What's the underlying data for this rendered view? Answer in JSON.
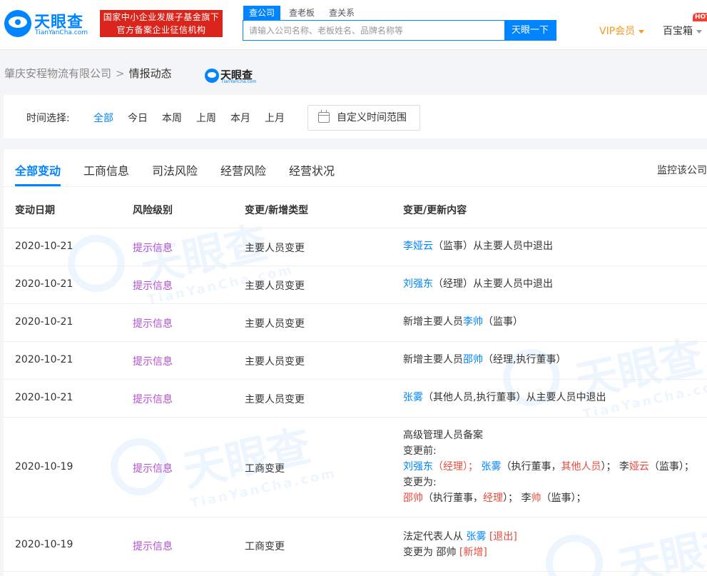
{
  "header": {
    "logo_cn": "天眼查",
    "logo_en": "TianYanCha.com",
    "gov_badge_line1": "国家中小企业发展子基金旗下",
    "gov_badge_line2": "官方备案企业征信机构",
    "search_tabs": [
      "查公司",
      "查老板",
      "查关系"
    ],
    "search_placeholder": "请输入公司名称、老板姓名、品牌名称等",
    "search_button": "天眼一下",
    "vip": "VIP会员",
    "baibao": "百宝箱",
    "hot": "HOT"
  },
  "breadcrumb": {
    "company": "肇庆安程物流有限公司",
    "separator": ">",
    "current": "情报动态",
    "small_logo_cn": "天眼查",
    "small_logo_en": "TianYanCha.com"
  },
  "filter": {
    "label": "时间选择:",
    "options": [
      "全部",
      "今日",
      "本周",
      "上周",
      "本月",
      "上月"
    ],
    "selected": "全部",
    "custom_range": "自定义时间范围"
  },
  "tabs": {
    "items": [
      "全部变动",
      "工商信息",
      "司法风险",
      "经营风险",
      "经营状况"
    ],
    "active": "全部变动",
    "monitor": "监控该公司"
  },
  "table": {
    "headers": [
      "变动日期",
      "风险级别",
      "变更/新增类型",
      "变更/更新内容"
    ],
    "rows": [
      {
        "date": "2020-10-21",
        "risk": "提示信息",
        "type": "主要人员变更",
        "c": [
          "李娅云",
          "（监事）从主要人员中退出"
        ]
      },
      {
        "date": "2020-10-21",
        "risk": "提示信息",
        "type": "主要人员变更",
        "c": [
          "刘强东",
          "（经理）从主要人员中退出"
        ]
      },
      {
        "date": "2020-10-21",
        "risk": "提示信息",
        "type": "主要人员变更",
        "c": [
          "新增主要人员",
          "李帅",
          "（监事）"
        ]
      },
      {
        "date": "2020-10-21",
        "risk": "提示信息",
        "type": "主要人员变更",
        "c": [
          "新增主要人员",
          "邵帅",
          "（经理,执行董事）"
        ]
      },
      {
        "date": "2020-10-21",
        "risk": "提示信息",
        "type": "主要人员变更",
        "c": [
          "张雾",
          "（其他人员,执行董事）从主要人员中退出"
        ]
      },
      {
        "date": "2020-10-19",
        "risk": "提示信息",
        "type": "工商变更",
        "c": [
          "高级管理人员备案",
          "变更前:",
          "刘强东",
          "（经理）；",
          "张雾",
          "（执行董事，",
          "其他人员",
          "）；",
          "李",
          "娅云",
          "（监事）；",
          "变更为:",
          "邵帅",
          "（执行董事，",
          "经理",
          "）；",
          "李",
          "帅",
          "（监事）；"
        ]
      },
      {
        "date": "2020-10-19",
        "risk": "提示信息",
        "type": "工商变更",
        "c": [
          "法定代表人从",
          "张雾",
          "[退出]",
          "变更为",
          "邵帅",
          "[新增]"
        ]
      }
    ]
  },
  "watermark": {
    "cn": "天眼查",
    "en": "TianYanCha.com"
  },
  "colors": {
    "brand": "#0084ff",
    "risk": "#b44ed3",
    "vip": "#f59a23",
    "badge": "#d9251c",
    "alert": "#e84c3d"
  }
}
